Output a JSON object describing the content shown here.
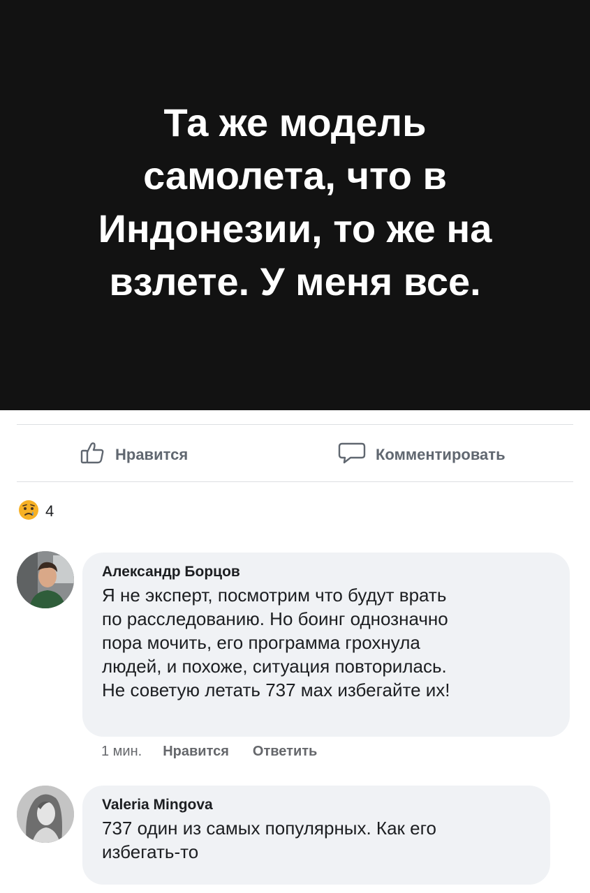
{
  "post": {
    "image_lines": [
      "Та же модель",
      "самолета, что в",
      "Индонезии, то же на",
      "взлете. У меня все."
    ]
  },
  "actions": {
    "like_label": "Нравится",
    "comment_label": "Комментировать"
  },
  "reactions": {
    "icon": "sad-face-icon",
    "count": "4"
  },
  "comments": [
    {
      "author": "Александр Борцов",
      "lines": [
        "Я не эксперт, посмотрим что будут врать",
        "по расследованию. Но боинг однозначно",
        "пора мочить, его программа грохнула",
        "людей, и похоже, ситуация повторилась.",
        "Не советую летать 737 мах избегайте их!"
      ],
      "time": "1 мин.",
      "like_label": "Нравится",
      "reply_label": "Ответить"
    },
    {
      "author": "Valeria Mingova",
      "lines": [
        "737 один из самых популярных. Как его",
        "избегать-то"
      ]
    }
  ],
  "colors": {
    "image_bg": "#121212",
    "bubble_bg": "#f0f2f5",
    "muted_text": "#606770",
    "reaction_yellow": "#f7b125"
  }
}
